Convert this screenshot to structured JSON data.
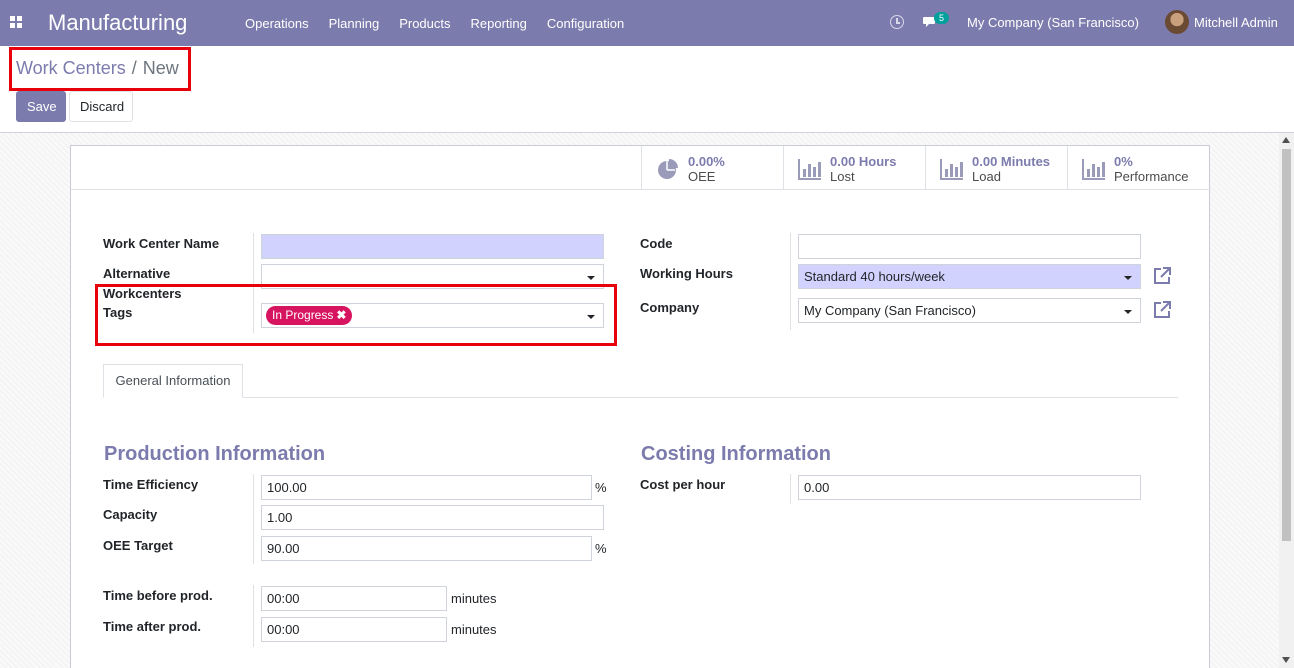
{
  "navbar": {
    "app_title": "Manufacturing",
    "menu": [
      "Operations",
      "Planning",
      "Products",
      "Reporting",
      "Configuration"
    ],
    "chat_count": "5",
    "company": "My Company (San Francisco)",
    "user": "Mitchell Admin"
  },
  "breadcrumb": {
    "parent": "Work Centers",
    "separator": "/",
    "current": "New"
  },
  "buttons": {
    "save": "Save",
    "discard": "Discard"
  },
  "stats": [
    {
      "value": "0.00%",
      "label": "OEE",
      "icon": "pie-chart-icon"
    },
    {
      "value": "0.00 Hours",
      "label": "Lost",
      "icon": "bar-chart-icon"
    },
    {
      "value": "0.00 Minutes",
      "label": "Load",
      "icon": "bar-chart-icon"
    },
    {
      "value": "0%",
      "label": "Performance",
      "icon": "bar-chart-icon"
    }
  ],
  "form": {
    "name_label": "Work Center Name",
    "name_value": "",
    "alt_label_line1": "Alternative",
    "alt_label_line2": "Workcenters",
    "alt_value": "",
    "tags_label": "Tags",
    "tag": "In Progress",
    "code_label": "Code",
    "code_value": "",
    "hours_label": "Working Hours",
    "hours_value": "Standard 40 hours/week",
    "company_label": "Company",
    "company_value": "My Company (San Francisco)"
  },
  "tab": {
    "label": "General Information"
  },
  "production": {
    "title": "Production Information",
    "time_eff_label": "Time Efficiency",
    "time_eff_value": "100.00",
    "capacity_label": "Capacity",
    "capacity_value": "1.00",
    "oee_label": "OEE Target",
    "oee_value": "90.00",
    "percent": "%",
    "before_label": "Time before prod.",
    "before_value": "00:00",
    "after_label": "Time after prod.",
    "after_value": "00:00",
    "minutes": "minutes"
  },
  "costing": {
    "title": "Costing Information",
    "cost_label": "Cost per hour",
    "cost_value": "0.00"
  },
  "colors": {
    "brand": "#7c7bad",
    "tag": "#d6145f",
    "required": "#d2d2ff",
    "annotation": "#e8000b"
  }
}
